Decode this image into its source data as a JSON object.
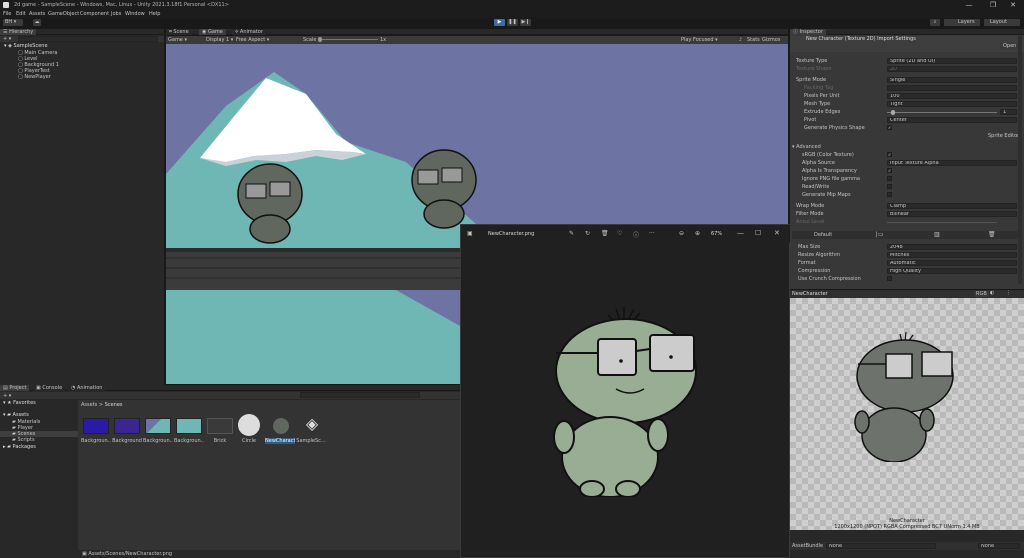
{
  "window": {
    "title": "2d game - SampleScene - Windows, Mac, Linux - Unity 2021.3.18f1 Personal <DX11>",
    "min": "—",
    "max": "❐",
    "close": "✕"
  },
  "menu": [
    "File",
    "Edit",
    "Assets",
    "GameObject",
    "Component",
    "Jobs",
    "Window",
    "Help"
  ],
  "toolbar": {
    "account": "BH ▾",
    "layers": "Layers",
    "layout": "Layout"
  },
  "hierarchy": {
    "tab": "Hierarchy",
    "scene": "SampleScene",
    "items": [
      "Main Camera",
      "Level",
      "Background 1",
      "PlayerTest",
      "NewPlayer"
    ]
  },
  "scene_tabs": [
    "Scene",
    "Game",
    "Animator"
  ],
  "game_bar": {
    "mode": "Game",
    "display": "Display 1",
    "aspect": "Free Aspect",
    "scale_label": "Scale",
    "scale_value": "1x",
    "play": "Play Focused",
    "stats": "Stats",
    "gizmos": "Gizmos"
  },
  "project": {
    "tabs": [
      "Project",
      "Console",
      "Animation"
    ],
    "favorites": "Favorites",
    "assets": "Assets",
    "folders": [
      "Materials",
      "Player",
      "Scenes",
      "Scripts"
    ],
    "packages": "Packages",
    "breadcrumb_root": "Assets",
    "breadcrumb_sep": ">",
    "breadcrumb_leaf": "Scenes",
    "items": [
      "Backgroun...",
      "Background",
      "Backgroun...",
      "Backgroun...",
      "Brick",
      "Circle",
      "NewCharact...",
      "SampleSc..."
    ],
    "path": "Assets/Scenes/NewCharacter.png"
  },
  "viewer": {
    "filename": "NewCharacter.png",
    "zoom": "67%"
  },
  "inspector": {
    "tab": "Inspector",
    "asset_title": "New Character (Texture 2D) Import Settings",
    "open": "Open",
    "rows": [
      {
        "label": "Texture Type",
        "value": "Sprite (2D and UI)"
      },
      {
        "label": "Texture Shape",
        "value": "2D"
      },
      {
        "label": "Sprite Mode",
        "value": "Single"
      },
      {
        "label": "Packing Tag",
        "value": ""
      },
      {
        "label": "Pixels Per Unit",
        "value": "100"
      },
      {
        "label": "Mesh Type",
        "value": "Tight"
      },
      {
        "label": "Extrude Edges",
        "value": "1"
      },
      {
        "label": "Pivot",
        "value": "Center"
      },
      {
        "label": "Generate Physics Shape",
        "value": "✓"
      }
    ],
    "sprite_editor": "Sprite Editor",
    "advanced": "Advanced",
    "adv_rows": [
      {
        "label": "sRGB (Color Texture)",
        "value": "✓"
      },
      {
        "label": "Alpha Source",
        "value": "Input Texture Alpha"
      },
      {
        "label": "Alpha Is Transparency",
        "value": "✓"
      },
      {
        "label": "Ignore PNG file gamma",
        "value": ""
      },
      {
        "label": "Read/Write",
        "value": ""
      },
      {
        "label": "Generate Mip Maps",
        "value": ""
      }
    ],
    "wrap_rows": [
      {
        "label": "Wrap Mode",
        "value": "Clamp"
      },
      {
        "label": "Filter Mode",
        "value": "Bilinear"
      },
      {
        "label": "Aniso Level",
        "value": ""
      }
    ],
    "platform": "Default",
    "plat_rows": [
      {
        "label": "Max Size",
        "value": "2048"
      },
      {
        "label": "Resize Algorithm",
        "value": "Mitchell"
      },
      {
        "label": "Format",
        "value": "Automatic"
      },
      {
        "label": "Compression",
        "value": "High Quality"
      },
      {
        "label": "Use Crunch Compression",
        "value": ""
      }
    ],
    "preview_title": "NewCharacter",
    "preview_rgb": "RGB",
    "preview_name": "NewCharacter",
    "preview_info": "1200x1200 (NPOT) RGBA Compressed BC7 UNorm 1.4 MB",
    "assetbundle_label": "AssetBundle",
    "assetbundle_value": "None",
    "assetbundle_variant": "None"
  }
}
